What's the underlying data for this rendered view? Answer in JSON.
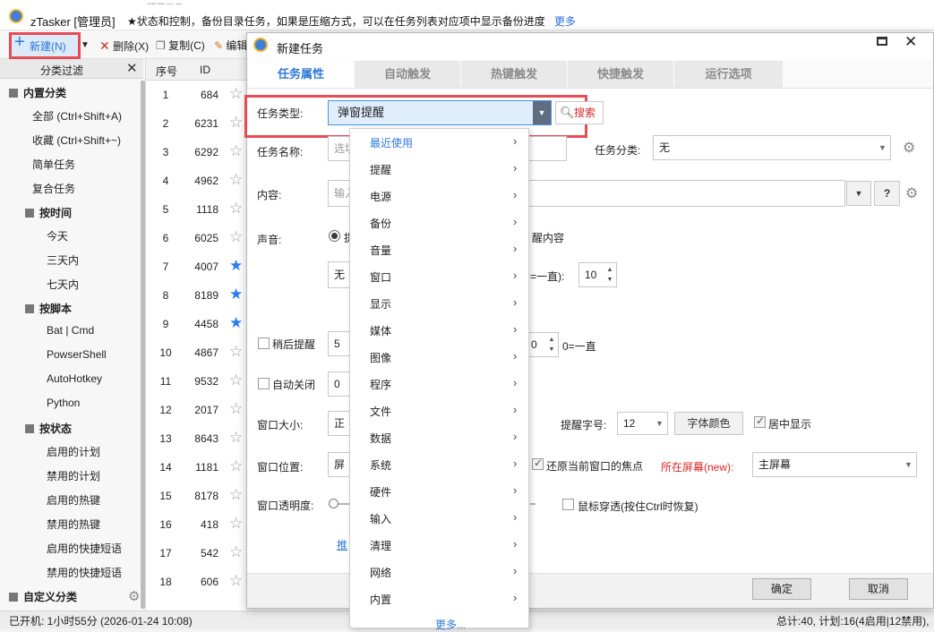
{
  "app": {
    "title": "zTasker [管理员]",
    "notice": "★状态和控制，备份目录任务，如果是压缩方式，可以在任务列表对应项中显示备份进度",
    "more_link": "更多",
    "taskbar_hint": "Excel版画工具"
  },
  "toolbar": {
    "new_label": "新建(N)",
    "delete_label": "删除(X)",
    "copy_label": "复制(C)",
    "edit_label": "编辑"
  },
  "sidebar": {
    "title": "分类过滤",
    "groups": [
      {
        "label": "内置分类",
        "items": [
          "全部 (Ctrl+Shift+A)",
          "收藏 (Ctrl+Shift+~)",
          "简单任务",
          "复合任务"
        ]
      },
      {
        "label": "按时间",
        "items": [
          "今天",
          "三天内",
          "七天内"
        ]
      },
      {
        "label": "按脚本",
        "items": [
          "Bat | Cmd",
          "PowserShell",
          "AutoHotkey",
          "Python"
        ]
      },
      {
        "label": "按状态",
        "items": [
          "启用的计划",
          "禁用的计划",
          "启用的热键",
          "禁用的热键",
          "启用的快捷短语",
          "禁用的快捷短语"
        ]
      },
      {
        "label": "自定义分类",
        "items": []
      }
    ]
  },
  "list": {
    "col_no": "序号",
    "col_id": "ID",
    "rows": [
      {
        "no": "1",
        "id": "684",
        "fav": false
      },
      {
        "no": "2",
        "id": "6231",
        "fav": false
      },
      {
        "no": "3",
        "id": "6292",
        "fav": false
      },
      {
        "no": "4",
        "id": "4962",
        "fav": false
      },
      {
        "no": "5",
        "id": "1118",
        "fav": false
      },
      {
        "no": "6",
        "id": "6025",
        "fav": false
      },
      {
        "no": "7",
        "id": "4007",
        "fav": true
      },
      {
        "no": "8",
        "id": "8189",
        "fav": true
      },
      {
        "no": "9",
        "id": "4458",
        "fav": true
      },
      {
        "no": "10",
        "id": "4867",
        "fav": false
      },
      {
        "no": "11",
        "id": "9532",
        "fav": false
      },
      {
        "no": "12",
        "id": "2017",
        "fav": false
      },
      {
        "no": "13",
        "id": "8643",
        "fav": false
      },
      {
        "no": "14",
        "id": "1181",
        "fav": false
      },
      {
        "no": "15",
        "id": "8178",
        "fav": false
      },
      {
        "no": "16",
        "id": "418",
        "fav": false
      },
      {
        "no": "17",
        "id": "542",
        "fav": false
      },
      {
        "no": "18",
        "id": "606",
        "fav": false
      }
    ]
  },
  "dialog": {
    "title": "新建任务",
    "tabs": [
      "任务属性",
      "自动触发",
      "热键触发",
      "快捷触发",
      "运行选项"
    ],
    "task_type_label": "任务类型:",
    "task_type_value": "弹窗提醒",
    "search_label": "搜索",
    "task_name_label": "任务名称:",
    "task_name_placeholder": "选填",
    "category_label": "任务分类:",
    "category_value": "无",
    "content_label": "内容:",
    "content_placeholder": "输入",
    "help_label": "?",
    "sound_label": "声音:",
    "sound_option_a": "提",
    "sound_option_b": "醒内容",
    "sound_value": "无",
    "repeat_label": "=一直):",
    "repeat_value": "10",
    "snooze_label": "稍后提醒",
    "snooze_value": "5",
    "snooze_count_value": "0",
    "snooze_forever": "0=一直",
    "autoclose_label": "自动关闭",
    "autoclose_value": "0",
    "window_size_label": "窗口大小:",
    "window_size_value": "正",
    "font_size_label": "提醒字号:",
    "font_size_value": "12",
    "font_color_btn": "字体颜色",
    "center_label": "居中显示",
    "window_pos_label": "窗口位置:",
    "window_pos_value": "屏",
    "restore_focus_label": "还原当前窗口的焦点",
    "screen_label": "所在屏幕(new):",
    "screen_value": "主屏幕",
    "opacity_label": "窗口透明度:",
    "mouse_through_label": "鼠标穿透(按住Ctrl时恢复)",
    "recommend_link": "推",
    "ok_label": "确定",
    "cancel_label": "取消"
  },
  "menu": {
    "items": [
      "最近使用",
      "提醒",
      "电源",
      "备份",
      "音量",
      "窗口",
      "显示",
      "媒体",
      "图像",
      "程序",
      "文件",
      "数据",
      "系统",
      "硬件",
      "输入",
      "清理",
      "网络",
      "内置"
    ],
    "more_label": "更多..."
  },
  "status": {
    "uptime": "已开机: 1小时55分 (2026-01-24 10:08)",
    "summary": "总计:40, 计划:16(4启用|12禁用),"
  },
  "colors": {
    "accent_blue": "#2f79d8",
    "highlight_red": "#e94b55",
    "star_active": "#2a7ef0",
    "screen_label_red": "#d62828"
  }
}
